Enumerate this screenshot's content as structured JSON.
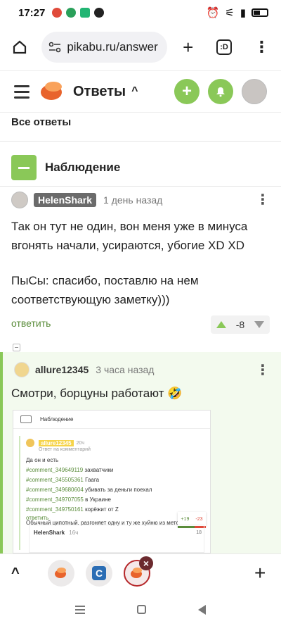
{
  "status_bar": {
    "time": "17:27",
    "battery_icon": "battery-icon",
    "wifi_icon": "wifi-icon",
    "alarm_icon": "alarm-icon"
  },
  "browser": {
    "url": "pikabu.ru/answer",
    "tab_count": ":D"
  },
  "site_header": {
    "title": "Ответы"
  },
  "section_label": "Все ответы",
  "post": {
    "title": "Наблюдение"
  },
  "comment1": {
    "username": "HelenShark",
    "time": "1 день назад",
    "text_line1": "Так он тут не один, вон меня уже в минуса вгонять начали, усираются, убогие XD XD",
    "text_line2": "ПыСы: спасибо, поставлю на нем соответствующую заметку)))",
    "reply": "ответить",
    "rating": "-8"
  },
  "comment2": {
    "username": "allure12345",
    "time": "3 часа назад",
    "text": "Смотри, борцуны работают 🤣",
    "embed": {
      "title": "Наблюдение",
      "user": "allure12345",
      "user_meta": "20ч",
      "sub": "Ответ на комментарий",
      "lines": [
        {
          "text": "Да он и есть",
          "link": false
        },
        {
          "text": "#comment_349649119",
          "link": true,
          "suffix": " захватчики"
        },
        {
          "text": "#comment_345505361",
          "link": true,
          "suffix": " Гаага"
        },
        {
          "text": "#comment_349680604",
          "link": true,
          "suffix": " убивать за деньги поехал"
        },
        {
          "text": "#comment_349707055",
          "link": true,
          "suffix": " в Украине"
        },
        {
          "text": "#comment_349750161",
          "link": true,
          "suffix": " корёжит от Z"
        }
      ],
      "footer_text": "Обычный ципотный, разгоняет одну и ту же хуйню из метод",
      "reply": "ответить",
      "vote_plus": "+19",
      "vote_minus": "-23",
      "vote_small": "18",
      "nested_user": "HelenShark",
      "nested_meta": "16ч"
    }
  }
}
